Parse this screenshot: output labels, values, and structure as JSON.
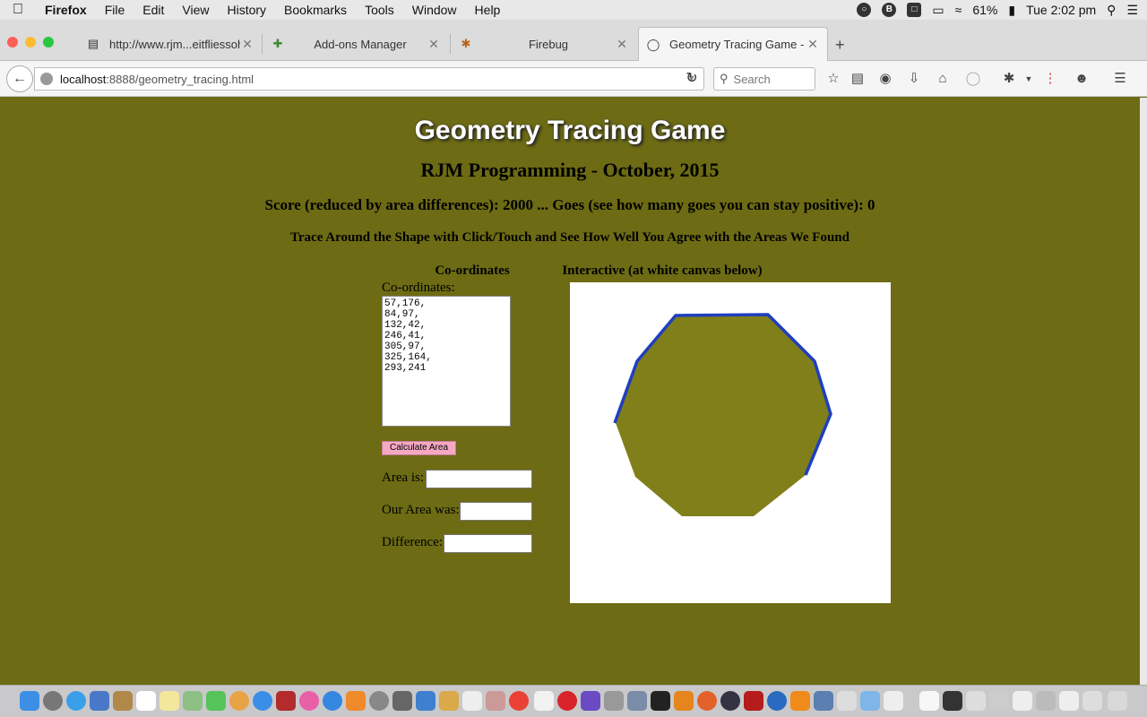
{
  "menubar": {
    "items": [
      {
        "label": "Firefox",
        "bold": true
      },
      {
        "label": "File"
      },
      {
        "label": "Edit"
      },
      {
        "label": "View"
      },
      {
        "label": "History"
      },
      {
        "label": "Bookmarks"
      },
      {
        "label": "Tools"
      },
      {
        "label": "Window"
      },
      {
        "label": "Help"
      }
    ],
    "battery": "61%",
    "clock": "Tue 2:02 pm"
  },
  "tabs": [
    {
      "label": "http://www.rjm...eitfliessohigh",
      "icon": "page-icon",
      "active": false
    },
    {
      "label": "Add-ons Manager",
      "icon": "puzzle-icon",
      "active": false
    },
    {
      "label": "Firebug",
      "icon": "bug-icon",
      "active": false
    },
    {
      "label": "Geometry Tracing Game - ...",
      "icon": "globe-icon",
      "active": true
    }
  ],
  "navbar": {
    "url_host": "localhost",
    "url_rest": ":8888/geometry_tracing.html",
    "search_placeholder": "Search"
  },
  "page": {
    "title": "Geometry Tracing Game",
    "subtitle": "RJM Programming - October, 2015",
    "score_line": "Score (reduced by area differences): 2000 ... Goes (see how many goes you can stay positive): 0",
    "instruction": "Trace Around the Shape with Click/Touch and See How Well You Agree with the Areas We Found",
    "col1_heading": "Co-ordinates",
    "col2_heading": "Interactive (at white canvas below)",
    "coord_label": "Co-ordinates:",
    "coords_value": "57,176,\n84,97,\n132,42,\n246,41,\n305,97,\n325,164,\n293,241",
    "calc_button": "Calculate Area",
    "area_label": "Area is:",
    "our_area_label": "Our Area was:",
    "difference_label": "Difference:",
    "area_value": "",
    "our_area_value": "",
    "difference_value": ""
  },
  "colors": {
    "page_bg": "#6d6b14",
    "shape_fill": "#817f19",
    "trace_stroke": "#1f3fbf",
    "button_bg": "#f4a8c4"
  }
}
